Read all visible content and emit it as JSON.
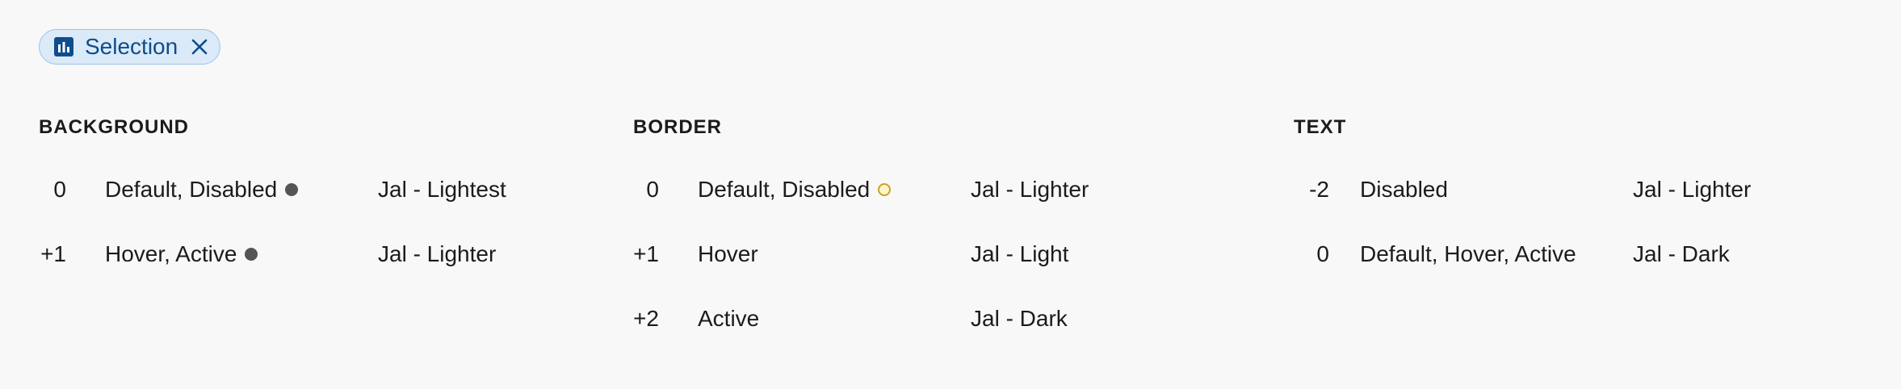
{
  "chip": {
    "label": "Selection",
    "icon": "bar-chart-icon",
    "close_icon": "close-icon",
    "color": "#0e4c8c"
  },
  "sections": {
    "background": {
      "title": "BACKGROUND",
      "rows": [
        {
          "level": "0",
          "state": "Default, Disabled",
          "token": "Jal - Lightest",
          "swatch": "#555555"
        },
        {
          "level": "+1",
          "state": "Hover, Active",
          "token": "Jal - Lighter",
          "swatch": "#555555"
        }
      ]
    },
    "border": {
      "title": "BORDER",
      "rows": [
        {
          "level": "0",
          "state": "Default, Disabled",
          "token": "Jal - Lighter",
          "swatch": "#c9a227"
        },
        {
          "level": "+1",
          "state": "Hover",
          "token": "Jal - Light"
        },
        {
          "level": "+2",
          "state": "Active",
          "token": "Jal - Dark"
        }
      ]
    },
    "text": {
      "title": "TEXT",
      "rows": [
        {
          "level": "-2",
          "state": "Disabled",
          "token": "Jal - Lighter"
        },
        {
          "level": "0",
          "state": "Default, Hover, Active",
          "token": "Jal - Dark"
        }
      ]
    }
  }
}
